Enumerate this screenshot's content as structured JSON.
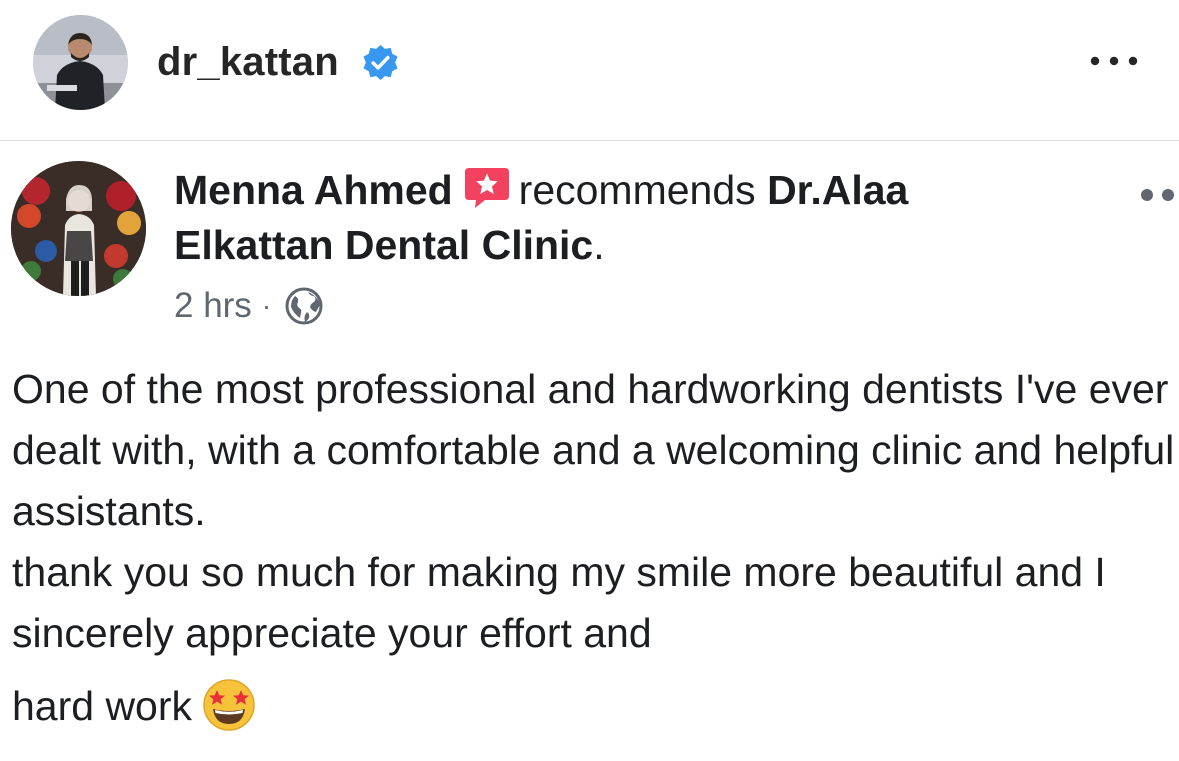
{
  "instagram_header": {
    "username": "dr_kattan",
    "verified_icon": "verified-badge-icon",
    "more_icon": "more-options-icon",
    "colors": {
      "verified": "#3897f0",
      "username": "#262626"
    }
  },
  "fb_post": {
    "author": "Menna Ahmed",
    "recommend_icon": "recommendation-star-icon",
    "verb": "recommends",
    "page_name": "Dr.Alaa Elkattan Dental Clinic",
    "end_punct": ".",
    "time": "2 hrs",
    "separator": "·",
    "audience_icon": "public-globe-icon",
    "more_icon": "more-options-icon",
    "body_lines": [
      "One of the most professional and hardworking dentists I've ever dealt with, with a comfortable and a welcoming clinic and helpful assistants.",
      "thank you so much for making my smile more beautiful and I sincerely appreciate your effort and",
      "hard work"
    ],
    "emoji": "star-struck-emoji-icon",
    "colors": {
      "recommend_icon": "#f3425f",
      "meta_text": "#606770",
      "text": "#1c1e21"
    }
  }
}
